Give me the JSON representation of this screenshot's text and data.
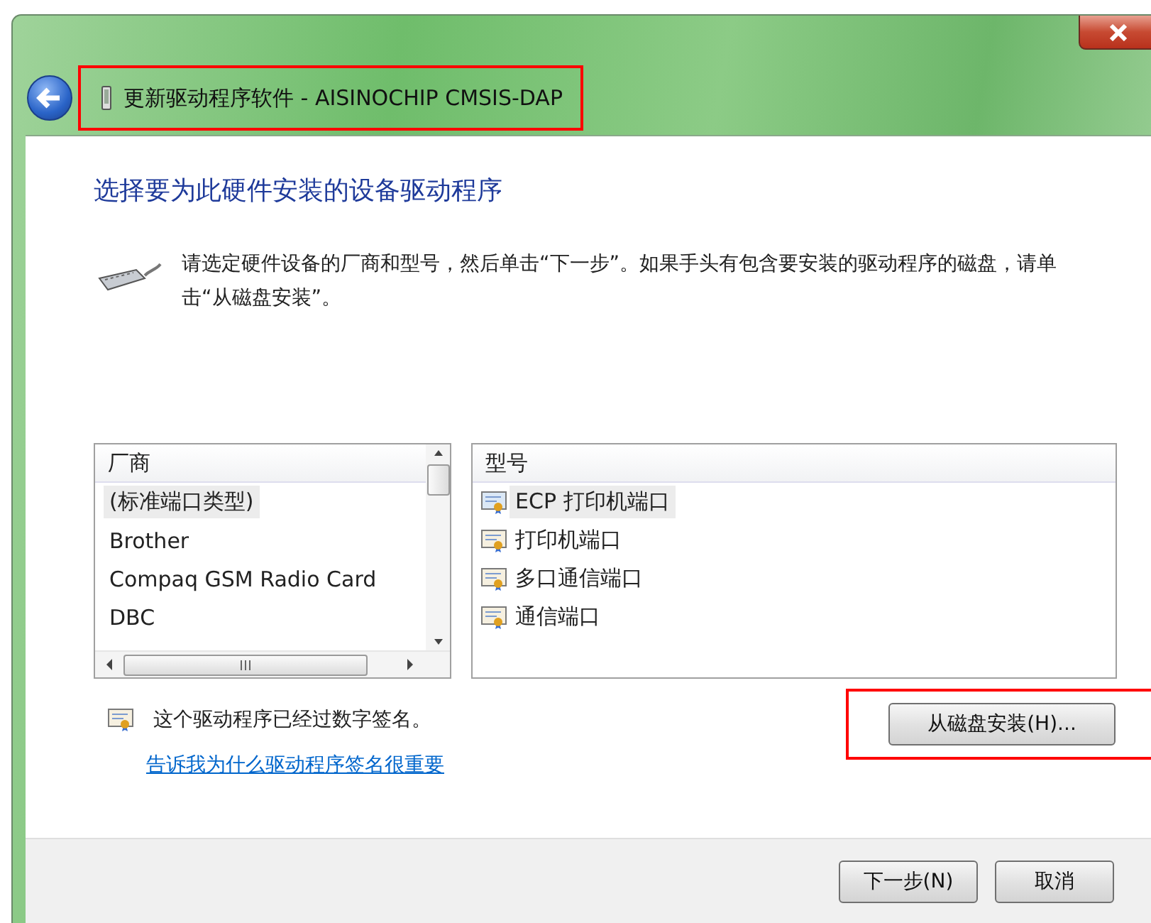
{
  "window": {
    "title": "更新驱动程序软件 - AISINOCHIP CMSIS-DAP",
    "title_highlighted": true
  },
  "heading": "选择要为此硬件安装的设备驱动程序",
  "description": "请选定硬件设备的厂商和型号，然后单击“下一步”。如果手头有包含要安装的驱动程序的磁盘，请单击“从磁盘安装”。",
  "manufacturers": {
    "header": "厂商",
    "items": [
      {
        "label": "(标准端口类型)",
        "selected": true
      },
      {
        "label": "Brother",
        "selected": false
      },
      {
        "label": "Compaq GSM Radio Card",
        "selected": false
      },
      {
        "label": "DBC",
        "selected": false
      }
    ]
  },
  "models": {
    "header": "型号",
    "items": [
      {
        "label": "ECP 打印机端口",
        "selected": true
      },
      {
        "label": "打印机端口",
        "selected": false
      },
      {
        "label": "多口通信端口",
        "selected": false
      },
      {
        "label": "通信端口",
        "selected": false
      }
    ]
  },
  "signature": {
    "text": "这个驱动程序已经过数字签名。",
    "link": "告诉我为什么驱动程序签名很重要"
  },
  "have_disk_button": {
    "label": "从磁盘安装(H)...",
    "highlighted": true
  },
  "footer_buttons": [
    "下一步(N)",
    "取消"
  ]
}
